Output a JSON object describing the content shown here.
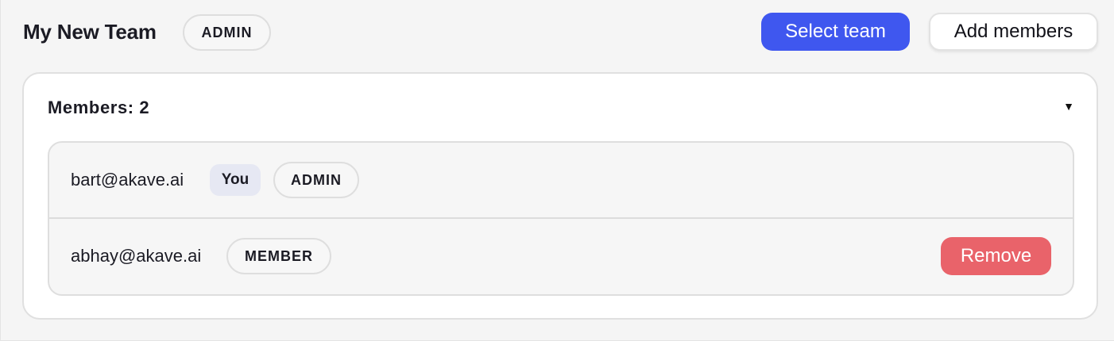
{
  "team": {
    "name": "My New Team",
    "role": "ADMIN"
  },
  "actions": {
    "select_team": "Select team",
    "add_members": "Add members"
  },
  "members_panel": {
    "count_label": "Members: 2",
    "toggle_glyph": "▼",
    "members": [
      {
        "email": "bart@akave.ai",
        "self_badge": "You",
        "role": "ADMIN"
      },
      {
        "email": "abhay@akave.ai",
        "role": "MEMBER",
        "remove_label": "Remove"
      }
    ]
  },
  "colors": {
    "primary": "#3f57ef",
    "danger": "#e9636a",
    "you_badge_bg": "#e6e8f3"
  }
}
